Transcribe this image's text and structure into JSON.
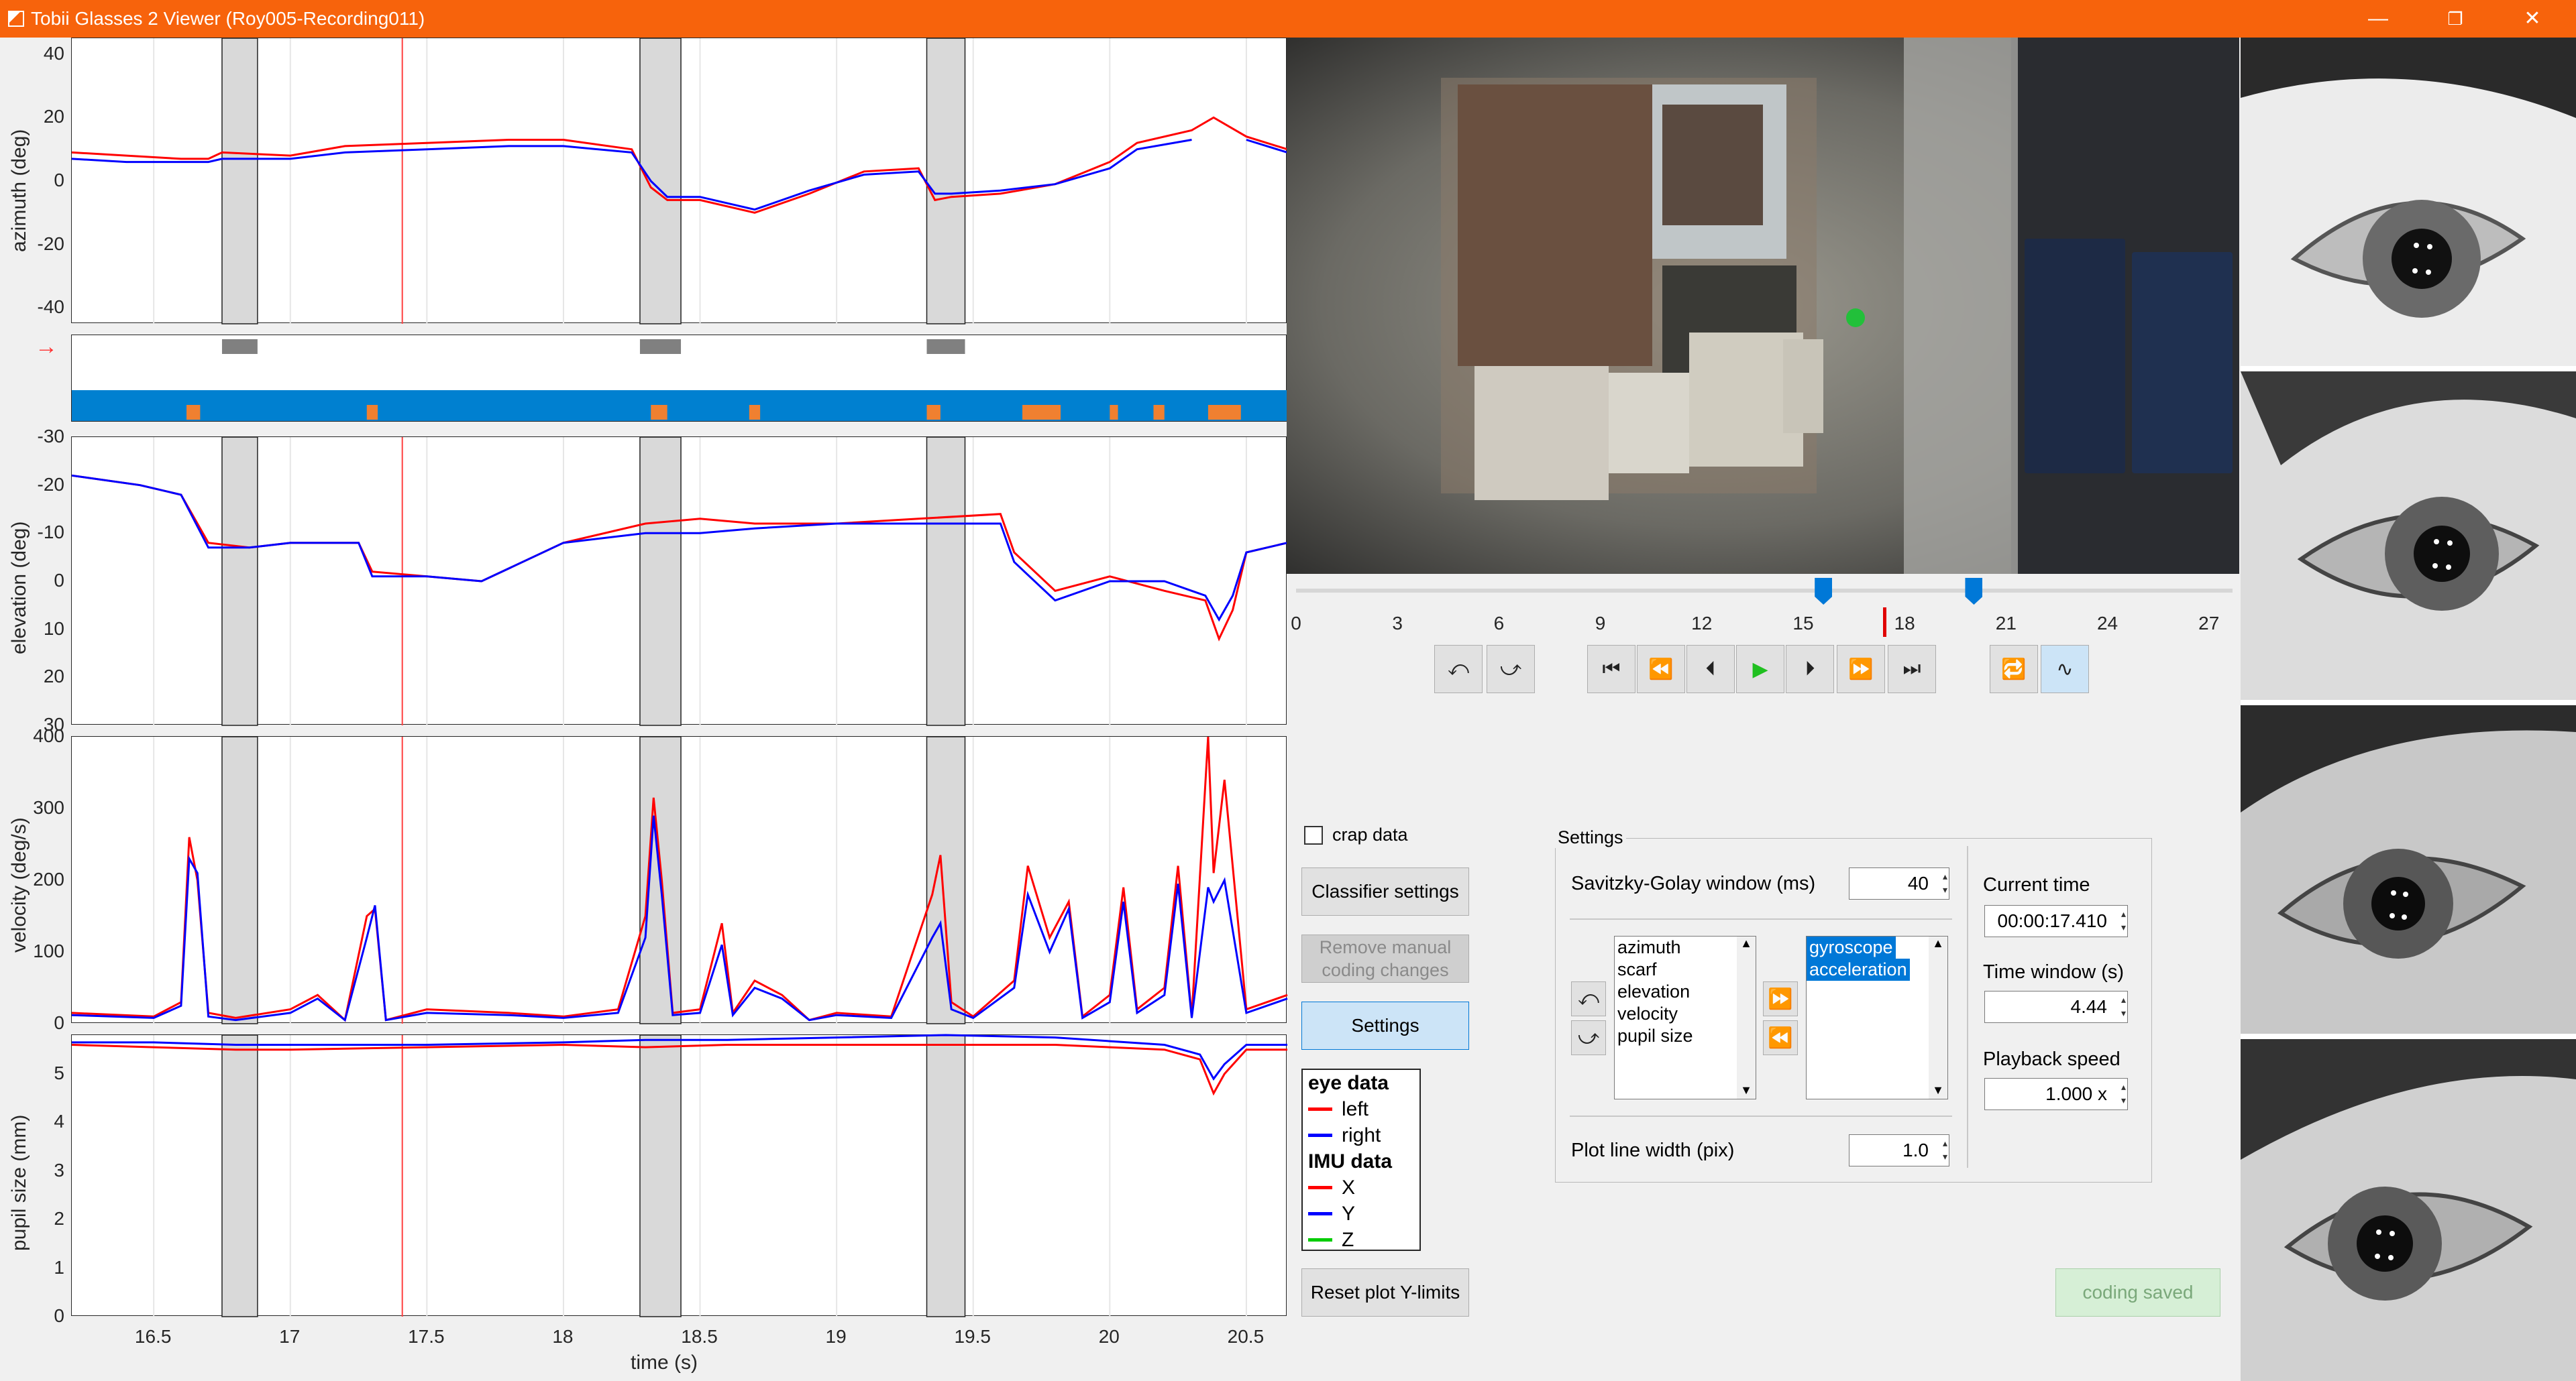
{
  "window": {
    "title": "Tobii Glasses 2 Viewer (Roy005-Recording011)",
    "minimize_glyph": "—",
    "restore_glyph": "❐",
    "close_glyph": "✕"
  },
  "plots": {
    "x_ticks": [
      "16.5",
      "17",
      "17.5",
      "18",
      "18.5",
      "19",
      "19.5",
      "20",
      "20.5"
    ],
    "xlabel": "time (s)",
    "azimuth": {
      "ylabel": "azimuth (deg)",
      "ticks": [
        "40",
        "20",
        "0",
        "-20",
        "-40"
      ]
    },
    "classifier": {
      "arrow": "→"
    },
    "elevation": {
      "ylabel": "elevation (deg)",
      "ticks": [
        "-30",
        "-20",
        "-10",
        "0",
        "10",
        "20",
        "30"
      ]
    },
    "velocity": {
      "ylabel": "velocity (deg/s)",
      "ticks": [
        "400",
        "300",
        "200",
        "100",
        "0"
      ]
    },
    "pupil": {
      "ylabel": "pupil size (mm)",
      "ticks": [
        "5",
        "4",
        "3",
        "2",
        "1",
        "0"
      ]
    }
  },
  "chart_data": {
    "type": "line",
    "x_range": [
      16.2,
      20.65
    ],
    "current_time": 17.41,
    "marked_intervals": [
      [
        16.75,
        16.88
      ],
      [
        18.28,
        18.43
      ],
      [
        19.33,
        19.47
      ]
    ],
    "classification_events": [
      [
        16.62,
        16.67
      ],
      [
        17.28,
        17.32
      ],
      [
        18.32,
        18.38
      ],
      [
        18.68,
        18.72
      ],
      [
        19.33,
        19.38
      ],
      [
        19.68,
        19.82
      ],
      [
        20.0,
        20.03
      ],
      [
        20.16,
        20.2
      ],
      [
        20.36,
        20.48
      ]
    ],
    "series_colors": {
      "left": "#ff0000",
      "right": "#0000ff"
    },
    "azimuth": {
      "ylim": [
        -45,
        45
      ],
      "left": {
        "x": [
          16.2,
          16.4,
          16.6,
          16.7,
          16.75,
          17.0,
          17.2,
          17.5,
          17.8,
          18.0,
          18.25,
          18.32,
          18.38,
          18.5,
          18.7,
          18.9,
          19.1,
          19.3,
          19.36,
          19.42,
          19.6,
          19.8,
          20.0,
          20.1,
          20.3,
          20.38,
          20.5,
          20.65
        ],
        "y": [
          9,
          8,
          7,
          7,
          9,
          8,
          11,
          12,
          13,
          13,
          10,
          -2,
          -6,
          -6,
          -10,
          -4,
          3,
          4,
          -6,
          -5,
          -4,
          -1,
          6,
          12,
          16,
          20,
          14,
          10
        ]
      },
      "right": {
        "x": [
          16.2,
          16.4,
          16.6,
          16.7,
          16.75,
          17.0,
          17.2,
          17.5,
          17.8,
          18.0,
          18.25,
          18.32,
          18.38,
          18.5,
          18.7,
          18.9,
          19.1,
          19.3,
          19.36,
          19.42,
          19.6,
          19.8,
          20.0,
          20.1,
          20.3,
          20.38,
          20.5,
          20.65
        ],
        "y": [
          7,
          6,
          6,
          6,
          7,
          7,
          9,
          10,
          11,
          11,
          9,
          0,
          -5,
          -5,
          -9,
          -3,
          2,
          3,
          -4,
          -4,
          -3,
          -1,
          4,
          10,
          13,
          null,
          13,
          9
        ]
      }
    },
    "elevation": {
      "ylim": [
        30,
        -30
      ],
      "left": {
        "x": [
          16.2,
          16.45,
          16.6,
          16.7,
          16.85,
          17.0,
          17.25,
          17.3,
          17.5,
          17.7,
          18.0,
          18.3,
          18.5,
          18.7,
          19.0,
          19.3,
          19.6,
          19.65,
          19.8,
          20.0,
          20.2,
          20.35,
          20.4,
          20.45,
          20.5,
          20.65
        ],
        "y": [
          -22,
          -20,
          -18,
          -8,
          -7,
          -8,
          -8,
          -2,
          -1,
          0,
          -8,
          -12,
          -13,
          -12,
          -12,
          -13,
          -14,
          -6,
          2,
          -1,
          2,
          4,
          12,
          6,
          -6,
          -8
        ]
      },
      "right": {
        "x": [
          16.2,
          16.45,
          16.6,
          16.7,
          16.85,
          17.0,
          17.25,
          17.3,
          17.5,
          17.7,
          18.0,
          18.3,
          18.5,
          18.7,
          19.0,
          19.3,
          19.6,
          19.65,
          19.8,
          20.0,
          20.2,
          20.35,
          20.4,
          20.45,
          20.5,
          20.65
        ],
        "y": [
          -22,
          -20,
          -18,
          -7,
          -7,
          -8,
          -8,
          -1,
          -1,
          0,
          -8,
          -10,
          -10,
          -11,
          -12,
          -12,
          -12,
          -4,
          4,
          0,
          0,
          3,
          8,
          3,
          -6,
          -8
        ]
      }
    },
    "velocity": {
      "ylim": [
        0,
        400
      ],
      "left": {
        "x": [
          16.2,
          16.5,
          16.6,
          16.63,
          16.66,
          16.7,
          16.8,
          17.0,
          17.1,
          17.2,
          17.28,
          17.31,
          17.35,
          17.5,
          17.8,
          18.0,
          18.2,
          18.3,
          18.33,
          18.36,
          18.4,
          18.5,
          18.58,
          18.62,
          18.7,
          18.8,
          18.9,
          19.0,
          19.2,
          19.35,
          19.38,
          19.42,
          19.5,
          19.65,
          19.7,
          19.78,
          19.85,
          19.9,
          20.0,
          20.05,
          20.1,
          20.2,
          20.25,
          20.3,
          20.36,
          20.38,
          20.42,
          20.5,
          20.65
        ],
        "y": [
          15,
          10,
          30,
          260,
          200,
          15,
          8,
          20,
          40,
          5,
          150,
          160,
          5,
          20,
          15,
          10,
          20,
          150,
          315,
          200,
          15,
          20,
          140,
          15,
          60,
          40,
          5,
          15,
          10,
          180,
          235,
          30,
          10,
          60,
          220,
          120,
          170,
          10,
          40,
          190,
          20,
          50,
          220,
          10,
          400,
          210,
          340,
          20,
          40
        ]
      },
      "right": {
        "x": [
          16.2,
          16.5,
          16.6,
          16.63,
          16.66,
          16.7,
          16.8,
          17.0,
          17.1,
          17.2,
          17.28,
          17.31,
          17.35,
          17.5,
          17.8,
          18.0,
          18.2,
          18.3,
          18.33,
          18.36,
          18.4,
          18.5,
          18.58,
          18.62,
          18.7,
          18.8,
          18.9,
          19.0,
          19.2,
          19.35,
          19.38,
          19.42,
          19.5,
          19.65,
          19.7,
          19.78,
          19.85,
          19.9,
          20.0,
          20.05,
          20.1,
          20.2,
          20.25,
          20.3,
          20.36,
          20.38,
          20.42,
          20.5,
          20.65
        ],
        "y": [
          12,
          8,
          25,
          230,
          210,
          10,
          5,
          15,
          35,
          5,
          120,
          165,
          5,
          15,
          12,
          8,
          15,
          120,
          290,
          180,
          12,
          15,
          110,
          12,
          50,
          35,
          5,
          12,
          8,
          120,
          140,
          20,
          8,
          50,
          180,
          100,
          160,
          8,
          30,
          170,
          15,
          40,
          195,
          8,
          190,
          170,
          200,
          15,
          35
        ]
      }
    },
    "pupil": {
      "ylim": [
        0,
        5.8
      ],
      "left": {
        "x": [
          16.2,
          16.5,
          16.8,
          17.0,
          17.5,
          18.0,
          18.3,
          18.6,
          19.0,
          19.4,
          19.8,
          20.2,
          20.33,
          20.38,
          20.42,
          20.5,
          20.65
        ],
        "y": [
          5.6,
          5.55,
          5.5,
          5.5,
          5.55,
          5.6,
          5.55,
          5.6,
          5.6,
          5.6,
          5.6,
          5.5,
          5.3,
          4.6,
          5.0,
          5.5,
          5.5
        ]
      },
      "right": {
        "x": [
          16.2,
          16.5,
          16.8,
          17.0,
          17.5,
          18.0,
          18.3,
          18.6,
          19.0,
          19.4,
          19.8,
          20.2,
          20.33,
          20.38,
          20.42,
          20.5,
          20.65
        ],
        "y": [
          5.65,
          5.65,
          5.6,
          5.6,
          5.6,
          5.65,
          5.7,
          5.7,
          5.75,
          5.8,
          5.75,
          5.6,
          5.4,
          4.9,
          5.2,
          5.6,
          5.6
        ]
      }
    }
  },
  "timeline": {
    "ticks": [
      "0",
      "3",
      "6",
      "9",
      "12",
      "15",
      "18",
      "21",
      "24",
      "27"
    ],
    "window_start": 15.6,
    "window_end": 20.05,
    "current": 17.41,
    "max": 27.7
  },
  "playback": {
    "icons": [
      "undo-loop-icon",
      "redo-loop-icon",
      "skip-start-icon",
      "rewind-icon",
      "step-back-icon",
      "play-icon",
      "step-forward-icon",
      "fast-forward-icon",
      "skip-end-icon",
      "loop-icon",
      "smooth-icon"
    ],
    "glyphs": {
      "undo": "⤺",
      "redo": "⤻",
      "skip_start": "⏮",
      "rewind": "⏪",
      "step_back": "⏴",
      "play": "▶",
      "step_forward": "⏵",
      "fast_forward": "⏩",
      "skip_end": "⏭",
      "loop": "🔁",
      "smooth": "∿"
    }
  },
  "controls": {
    "crap_data_label": "crap data",
    "classifier_settings": "Classifier settings",
    "remove_manual": "Remove manual coding changes",
    "settings_button": "Settings",
    "reset_ylimits": "Reset plot Y-limits",
    "coding_saved": "coding saved"
  },
  "legend": {
    "eye_header": "eye data",
    "left": "left",
    "right": "right",
    "imu_header": "IMU data",
    "x": "X",
    "y": "Y",
    "z": "Z",
    "colors": {
      "left": "#ff0000",
      "right": "#0000ff",
      "x": "#ff0000",
      "y": "#0000ff",
      "z": "#00cc00"
    }
  },
  "settings_panel": {
    "title": "Settings",
    "sg_label": "Savitzky-Golay window (ms)",
    "sg_value": "40",
    "left_list": [
      "azimuth",
      "scarf",
      "elevation",
      "velocity",
      "pupil size"
    ],
    "right_list": [
      "gyroscope",
      "acceleration"
    ],
    "line_width_label": "Plot line width (pix)",
    "line_width_value": "1.0",
    "current_time_label": "Current time",
    "current_time_value": "00:00:17.410",
    "time_window_label": "Time window (s)",
    "time_window_value": "4.44",
    "playback_speed_label": "Playback speed",
    "playback_speed_value": "1.000 x"
  }
}
